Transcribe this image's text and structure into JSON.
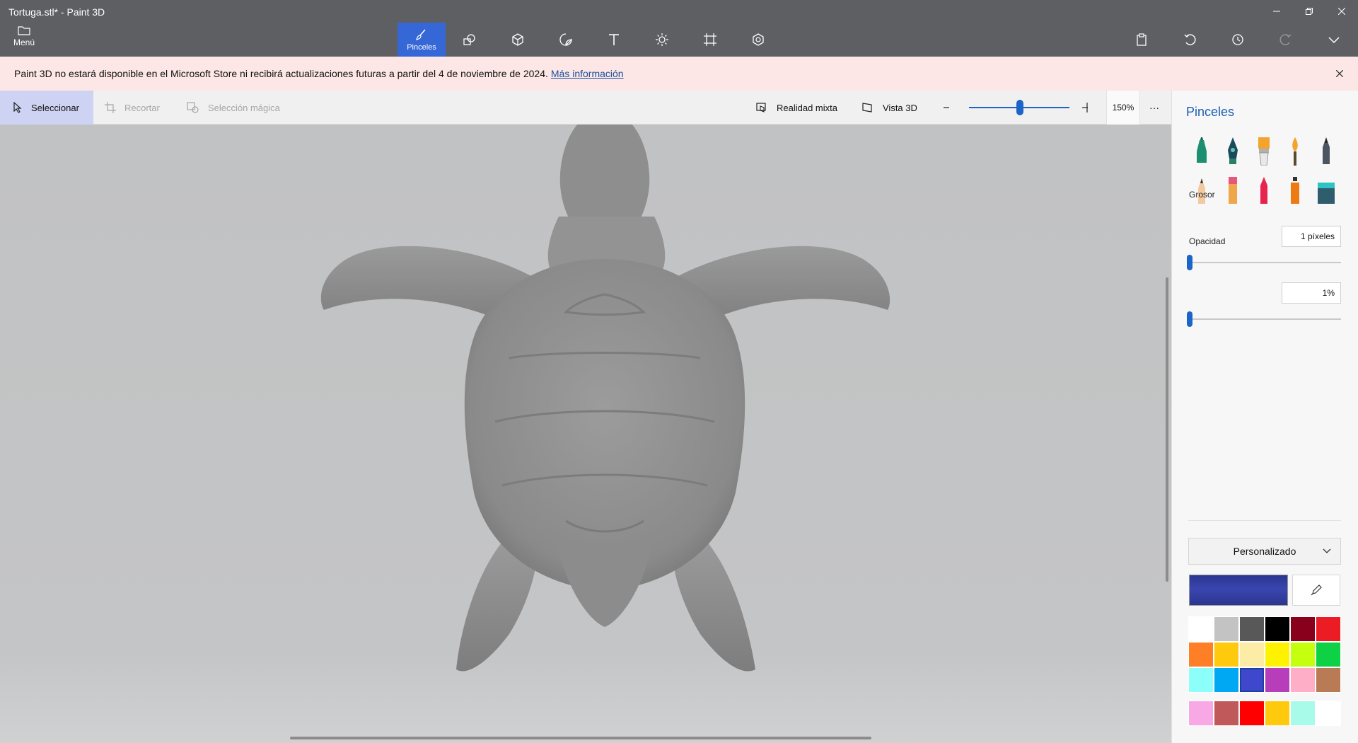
{
  "window": {
    "title": "Tortuga.stl* - Paint 3D"
  },
  "ribbon": {
    "menu_label": "Menú",
    "active_tool_label": "Pinceles",
    "tools": [
      "brushes",
      "2d-shapes",
      "3d-shapes",
      "stickers",
      "text",
      "effects",
      "canvas",
      "3d-library"
    ]
  },
  "banner": {
    "message": "Paint 3D no estará disponible en el Microsoft Store ni recibirá actualizaciones futuras a partir del 4 de noviembre de 2024.",
    "link": "Más información"
  },
  "commandbar": {
    "select": "Seleccionar",
    "crop": "Recortar",
    "magic_select": "Selección mágica",
    "mixed_reality": "Realidad mixta",
    "view_3d": "Vista 3D",
    "zoom": "150%",
    "more": "···"
  },
  "panel": {
    "title": "Pinceles",
    "brushes": [
      "marker",
      "calligraphy-pen",
      "oil-brush",
      "watercolor",
      "pixel-pen",
      "pencil",
      "eraser",
      "crayon",
      "spray-can",
      "fill"
    ],
    "thickness_label": "Grosor",
    "thickness_value": "1 píxeles",
    "thickness_level": 0.01,
    "opacity_label": "Opacidad",
    "opacity_value": "1%",
    "opacity_level": 0.01,
    "preset": "Personalizado",
    "active_color": "#2b3590",
    "palette": [
      "#ffffff",
      "#c3c3c3",
      "#585858",
      "#000000",
      "#88001b",
      "#ec1c24",
      "#ff7f27",
      "#ffc90e",
      "#fdeca6",
      "#fff200",
      "#c4ff0e",
      "#0ed145",
      "#8cfffb",
      "#00a8f3",
      "#3f48cc",
      "#b83dba",
      "#ffaec8",
      "#b97a56"
    ],
    "selected_swatch": 14,
    "custom_colors": [
      "#f9a8e6",
      "#c05a5a",
      "#ff0000",
      "#ffc90e",
      "#a8fbe9",
      "#ffffff"
    ]
  }
}
